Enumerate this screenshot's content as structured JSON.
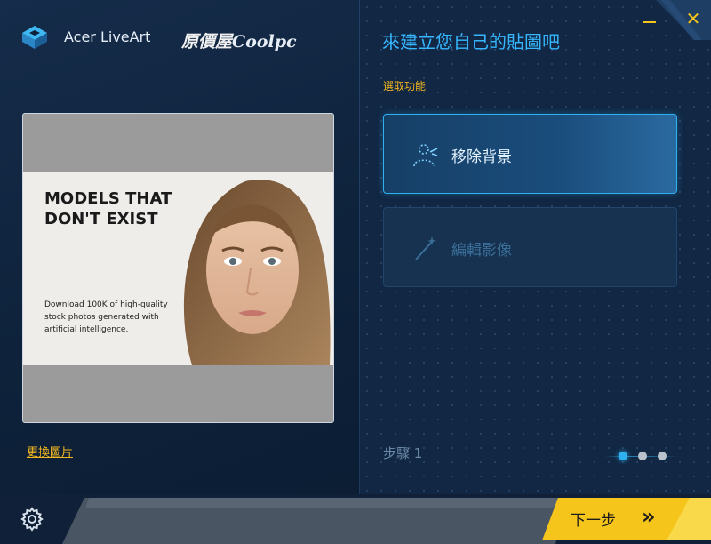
{
  "app": {
    "name": "Acer LiveArt",
    "brand_prefix": "原價屋",
    "brand_suffix": "Coolpc"
  },
  "preview": {
    "headline": "MODELS THAT DON'T EXIST",
    "body": "Download 100K of high-quality stock photos generated with artificial intelligence.",
    "change_link": "更換圖片"
  },
  "panel": {
    "headline": "來建立您自己的貼圖吧",
    "section_label": "選取功能",
    "options": [
      {
        "label": "移除背景",
        "icon": "remove-background-icon",
        "state": "active"
      },
      {
        "label": "編輯影像",
        "icon": "magic-wand-icon",
        "state": "disabled"
      }
    ],
    "step_label": "步驟 1",
    "pager": {
      "total": 3,
      "current": 1
    }
  },
  "footer": {
    "next_label": "下一步",
    "next_arrow": "»"
  },
  "colors": {
    "accent_blue": "#2fb1f0",
    "accent_yellow": "#f5c51c",
    "background": "#0e223b"
  },
  "icons": {
    "logo": "acer-liveart-logo-icon",
    "minimize": "minimize-icon",
    "close": "close-icon",
    "settings": "gear-icon",
    "next": "double-chevron-right-icon"
  }
}
